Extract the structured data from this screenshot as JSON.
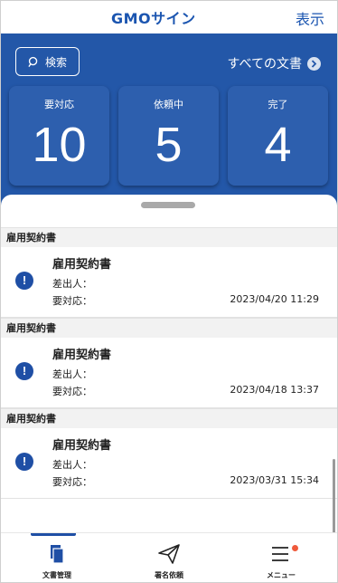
{
  "header": {
    "logo_gmo": "GMO",
    "logo_sign": "サイン",
    "action_label": "表示"
  },
  "summary": {
    "search_label": "検索",
    "all_docs_label": "すべての文書",
    "cards": [
      {
        "label": "要対応",
        "count": "10"
      },
      {
        "label": "依頼中",
        "count": "5"
      },
      {
        "label": "完了",
        "count": "4"
      }
    ]
  },
  "documents": [
    {
      "group": "雇用契約書",
      "title": "雇用契約書",
      "sender_label": "差出人：",
      "due_label": "要対応：",
      "date": "2023/04/20 11:29"
    },
    {
      "group": "雇用契約書",
      "title": "雇用契約書",
      "sender_label": "差出人：",
      "due_label": "要対応：",
      "date": "2023/04/18 13:37"
    },
    {
      "group": "雇用契約書",
      "title": "雇用契約書",
      "sender_label": "差出人：",
      "due_label": "要対応：",
      "date": "2023/03/31 15:34"
    }
  ],
  "bottom_nav": [
    {
      "label": "文書管理",
      "icon": "documents-icon",
      "active": true
    },
    {
      "label": "署名依頼",
      "icon": "paper-plane-icon",
      "active": false
    },
    {
      "label": "メニュー",
      "icon": "menu-icon",
      "active": false
    }
  ],
  "colors": {
    "brand_blue": "#2357a8",
    "card_blue": "#2d5fae",
    "notification_dot": "#ef5a3c"
  }
}
